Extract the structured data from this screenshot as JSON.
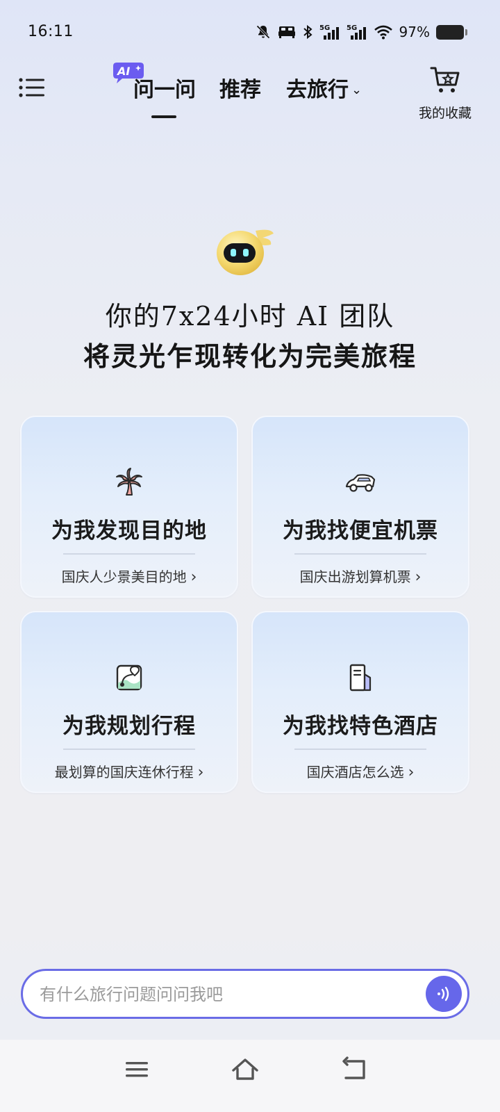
{
  "status_bar": {
    "time": "16:11",
    "network_1": "5G",
    "network_2": "5G",
    "battery_percent": "97%",
    "icons": [
      "mute-icon",
      "bed-icon",
      "bluetooth-icon",
      "signal-5g-icon",
      "signal-5g-icon",
      "wifi-icon",
      "battery-icon"
    ]
  },
  "header": {
    "menu_icon": "hamburger-menu-icon",
    "ai_badge": "AI",
    "tabs": [
      {
        "label": "问一问",
        "active": true
      },
      {
        "label": "推荐",
        "active": false
      },
      {
        "label": "去旅行",
        "active": false,
        "dropdown": true
      }
    ],
    "favorites_label": "我的收藏",
    "favorites_icon": "shopping-cart-star-icon"
  },
  "hero": {
    "line1": "你的7x24小时 AI 团队",
    "line2": "将灵光乍现转化为完美旅程"
  },
  "cards": [
    {
      "icon": "palm-tree-icon",
      "title": "为我发现目的地",
      "subtitle": "国庆人少景美目的地"
    },
    {
      "icon": "car-icon",
      "title": "为我找便宜机票",
      "subtitle": "国庆出游划算机票"
    },
    {
      "icon": "map-route-icon",
      "title": "为我规划行程",
      "subtitle": "最划算的国庆连休行程"
    },
    {
      "icon": "hotel-building-icon",
      "title": "为我找特色酒店",
      "subtitle": "国庆酒店怎么选"
    }
  ],
  "input": {
    "placeholder": "有什么旅行问题问问我吧",
    "value": "",
    "voice_icon": "voice-wave-icon"
  },
  "colors": {
    "accent": "#6667ea",
    "input_border": "#6a6ce6",
    "ai_badge": "#6b5cf0"
  },
  "nav": {
    "icons": [
      "menu-lines-icon",
      "home-icon",
      "back-icon"
    ]
  }
}
